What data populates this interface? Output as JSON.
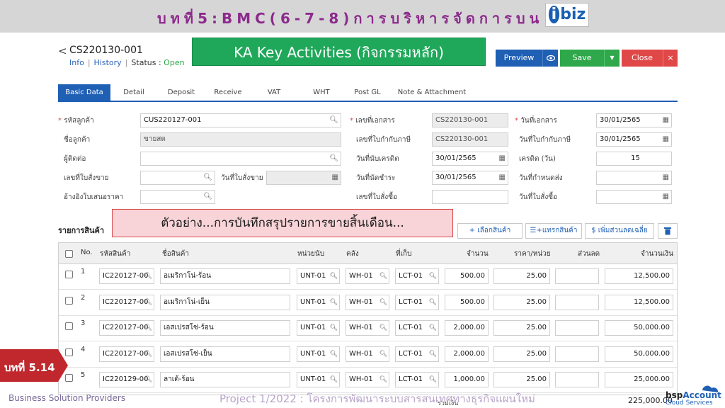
{
  "slide": {
    "title": "บทที่5:BMC(6-7-8)การบริหารจัดการบน",
    "logo_text": "biz",
    "logo_i": "i"
  },
  "header": {
    "back_glyph": "<",
    "doc_no": "CS220130-001",
    "links": {
      "info": "Info",
      "history": "History",
      "status_label": "Status :",
      "status_value": "Open"
    },
    "ka_banner": "KA Key Activities (กิจกรรมหลัก)"
  },
  "toolbar": {
    "preview": "Preview",
    "save": "Save",
    "close": "Close"
  },
  "tabs": [
    "Basic Data",
    "Detail",
    "Deposit",
    "Receive",
    "VAT",
    "WHT",
    "Post GL",
    "Note & Attachment"
  ],
  "form": {
    "customer_code_label": "รหัสลูกค้า",
    "customer_code": "CUS220127-001",
    "customer_name_label": "ชื่อลูกค้า",
    "customer_name": "ขายสด",
    "contact_label": "ผู้ติดต่อ",
    "so_no_label": "เลขที่ใบสั่งขาย",
    "so_date_label": "วันที่ใบสั่งขาย",
    "quote_ref_label": "อ้างอิงใบเสนอราคา",
    "doc_no_label": "เลขที่เอกสาร",
    "doc_no": "CS220130-001",
    "tax_inv_no_label": "เลขที่ใบกำกับภาษี",
    "tax_inv_no": "CS220130-001",
    "credit_start_label": "วันที่นับเครดิต",
    "credit_start": "30/01/2565",
    "due_date_label": "วันที่นัดชำระ",
    "due_date": "30/01/2565",
    "po_no_label": "เลขที่ใบสั่งซื้อ",
    "doc_date_label": "วันที่เอกสาร",
    "doc_date": "30/01/2565",
    "tax_inv_date_label": "วันที่ใบกำกับภาษี",
    "tax_inv_date": "30/01/2565",
    "credit_days_label": "เครดิต (วัน)",
    "credit_days": "15",
    "delivery_date_label": "วันที่กำหนดส่ง",
    "po_date_label": "วันที่ใบสั่งซื้อ"
  },
  "items_section": {
    "title": "รายการสินค้า",
    "example_banner": "ตัวอย่าง...การบันทึกสรุปรายการขายสิ้นเดือน...",
    "select_product": "+ เลือกสินค้า",
    "insert_product": "แทรกสินค้า",
    "add_discount": "$ เพิ่มส่วนลดเฉลี่ย"
  },
  "table": {
    "headers": {
      "no": "No.",
      "code": "รหัสสินค้า",
      "name": "ชื่อสินค้า",
      "unit": "หน่วยนับ",
      "wh": "คลัง",
      "loc": "ที่เก็บ",
      "qty": "จำนวน",
      "price": "ราคา/หน่วย",
      "discount": "ส่วนลด",
      "amount": "จำนวนเงิน"
    },
    "rows": [
      {
        "no": "1",
        "code": "IC220127-00",
        "name": "อเมริกาโน่-ร้อน",
        "unit": "UNT-01",
        "wh": "WH-01",
        "loc": "LCT-01",
        "qty": "500.00",
        "price": "25.00",
        "amount": "12,500.00"
      },
      {
        "no": "2",
        "code": "IC220127-00",
        "name": "อเมริกาโน่-เย็น",
        "unit": "UNT-01",
        "wh": "WH-01",
        "loc": "LCT-01",
        "qty": "500.00",
        "price": "25.00",
        "amount": "12,500.00"
      },
      {
        "no": "3",
        "code": "IC220127-00",
        "name": "เอสเปรสโซ่-ร้อน",
        "unit": "UNT-01",
        "wh": "WH-01",
        "loc": "LCT-01",
        "qty": "2,000.00",
        "price": "25.00",
        "amount": "50,000.00"
      },
      {
        "no": "4",
        "code": "IC220127-00",
        "name": "เอสเปรสโซ่-เย็น",
        "unit": "UNT-01",
        "wh": "WH-01",
        "loc": "LCT-01",
        "qty": "2,000.00",
        "price": "25.00",
        "amount": "50,000.00"
      },
      {
        "no": "5",
        "code": "IC220129-00",
        "name": "ลาเต้-ร้อน",
        "unit": "UNT-01",
        "wh": "WH-01",
        "loc": "LCT-01",
        "qty": "1,000.00",
        "price": "25.00",
        "amount": "25,000.00"
      }
    ],
    "total_label": "รวมเงิน",
    "total_value": "225,000.00"
  },
  "footer": {
    "lesson": "บทที่ 5.14",
    "left": "Business Solution Providers",
    "middle": "Project 1/2022 : โครงการพัฒนาระบบสารสนเทศทางธุรกิจแผนใหม่",
    "bsp_a": "bsp",
    "bsp_b": "Account",
    "bsp_sub": "Cloud Services"
  },
  "colors": {
    "primary": "#1f5fb4",
    "success": "#2ea84a",
    "danger": "#e04848",
    "title_purple": "#8c2a8c"
  }
}
